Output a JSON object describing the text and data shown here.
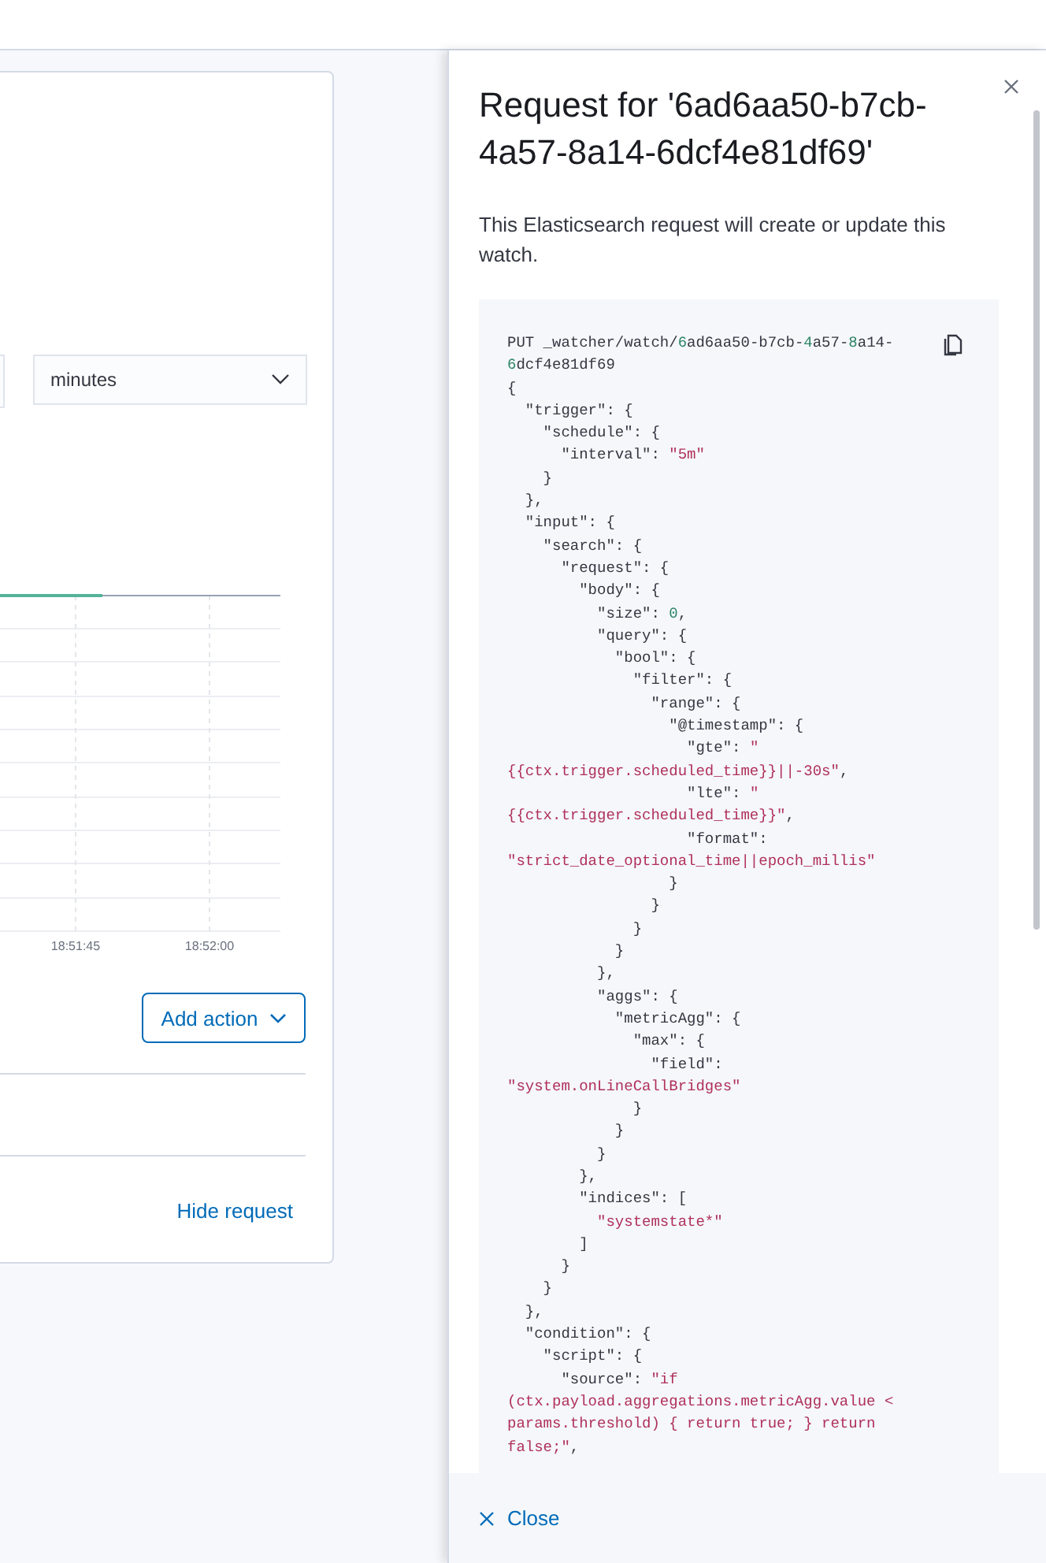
{
  "main_card": {
    "unit_select": {
      "value": "minutes"
    },
    "chart": {
      "x_ticks": [
        "18:51:45",
        "18:52:00"
      ]
    },
    "add_action_button": "Add action",
    "hide_request_link": "Hide request"
  },
  "flyout": {
    "title": "Request for '6ad6aa50-b7cb-4a57-8a14-6dcf4e81df69'",
    "description": "This Elasticsearch request will create or update this watch.",
    "code_lines": [
      [
        {
          "kind": "plain",
          "text": "PUT _watcher/watch/"
        },
        {
          "kind": "number",
          "text": "6"
        },
        {
          "kind": "plain",
          "text": "ad6aa50-b7cb-"
        },
        {
          "kind": "number",
          "text": "4"
        },
        {
          "kind": "plain",
          "text": "a57-"
        },
        {
          "kind": "number",
          "text": "8"
        },
        {
          "kind": "plain",
          "text": "a14-"
        }
      ],
      [
        {
          "kind": "number",
          "text": "6"
        },
        {
          "kind": "plain",
          "text": "dcf4e81df69"
        }
      ],
      [
        {
          "kind": "plain",
          "text": "{"
        }
      ],
      [
        {
          "kind": "plain",
          "text": "  \"trigger\": {"
        }
      ],
      [
        {
          "kind": "plain",
          "text": "    \"schedule\": {"
        }
      ],
      [
        {
          "kind": "plain",
          "text": "      \"interval\": "
        },
        {
          "kind": "string",
          "text": "\"5m\""
        }
      ],
      [
        {
          "kind": "plain",
          "text": "    }"
        }
      ],
      [
        {
          "kind": "plain",
          "text": "  },"
        }
      ],
      [
        {
          "kind": "plain",
          "text": "  \"input\": {"
        }
      ],
      [
        {
          "kind": "plain",
          "text": "    \"search\": {"
        }
      ],
      [
        {
          "kind": "plain",
          "text": "      \"request\": {"
        }
      ],
      [
        {
          "kind": "plain",
          "text": "        \"body\": {"
        }
      ],
      [
        {
          "kind": "plain",
          "text": "          \"size\": "
        },
        {
          "kind": "number",
          "text": "0"
        },
        {
          "kind": "plain",
          "text": ","
        }
      ],
      [
        {
          "kind": "plain",
          "text": "          \"query\": {"
        }
      ],
      [
        {
          "kind": "plain",
          "text": "            \"bool\": {"
        }
      ],
      [
        {
          "kind": "plain",
          "text": "              \"filter\": {"
        }
      ],
      [
        {
          "kind": "plain",
          "text": "                \"range\": {"
        }
      ],
      [
        {
          "kind": "plain",
          "text": "                  \"@timestamp\": {"
        }
      ],
      [
        {
          "kind": "plain",
          "text": "                    \"gte\": "
        },
        {
          "kind": "string",
          "text": "\""
        }
      ],
      [
        {
          "kind": "string",
          "text": "{{ctx.trigger.scheduled_time}}||-30s\""
        },
        {
          "kind": "plain",
          "text": ","
        }
      ],
      [
        {
          "kind": "plain",
          "text": "                    \"lte\": "
        },
        {
          "kind": "string",
          "text": "\""
        }
      ],
      [
        {
          "kind": "string",
          "text": "{{ctx.trigger.scheduled_time}}\""
        },
        {
          "kind": "plain",
          "text": ","
        }
      ],
      [
        {
          "kind": "plain",
          "text": "                    \"format\":"
        }
      ],
      [
        {
          "kind": "string",
          "text": "\"strict_date_optional_time||epoch_millis\""
        }
      ],
      [
        {
          "kind": "plain",
          "text": "                  }"
        }
      ],
      [
        {
          "kind": "plain",
          "text": "                }"
        }
      ],
      [
        {
          "kind": "plain",
          "text": "              }"
        }
      ],
      [
        {
          "kind": "plain",
          "text": "            }"
        }
      ],
      [
        {
          "kind": "plain",
          "text": "          },"
        }
      ],
      [
        {
          "kind": "plain",
          "text": "          \"aggs\": {"
        }
      ],
      [
        {
          "kind": "plain",
          "text": "            \"metricAgg\": {"
        }
      ],
      [
        {
          "kind": "plain",
          "text": "              \"max\": {"
        }
      ],
      [
        {
          "kind": "plain",
          "text": "                \"field\":"
        }
      ],
      [
        {
          "kind": "string",
          "text": "\"system.onLineCallBridges\""
        }
      ],
      [
        {
          "kind": "plain",
          "text": "              }"
        }
      ],
      [
        {
          "kind": "plain",
          "text": "            }"
        }
      ],
      [
        {
          "kind": "plain",
          "text": "          }"
        }
      ],
      [
        {
          "kind": "plain",
          "text": "        },"
        }
      ],
      [
        {
          "kind": "plain",
          "text": "        \"indices\": ["
        }
      ],
      [
        {
          "kind": "string",
          "text": "          \"systemstate*\""
        }
      ],
      [
        {
          "kind": "plain",
          "text": "        ]"
        }
      ],
      [
        {
          "kind": "plain",
          "text": "      }"
        }
      ],
      [
        {
          "kind": "plain",
          "text": "    }"
        }
      ],
      [
        {
          "kind": "plain",
          "text": "  },"
        }
      ],
      [
        {
          "kind": "plain",
          "text": "  \"condition\": {"
        }
      ],
      [
        {
          "kind": "plain",
          "text": "    \"script\": {"
        }
      ],
      [
        {
          "kind": "plain",
          "text": "      \"source\": "
        },
        {
          "kind": "string",
          "text": "\"if"
        }
      ],
      [
        {
          "kind": "string",
          "text": "(ctx.payload.aggregations.metricAgg.value <"
        }
      ],
      [
        {
          "kind": "string",
          "text": "params.threshold) { return true; } return"
        }
      ],
      [
        {
          "kind": "string",
          "text": "false;\""
        },
        {
          "kind": "plain",
          "text": ","
        }
      ]
    ],
    "close_button": "Close"
  }
}
